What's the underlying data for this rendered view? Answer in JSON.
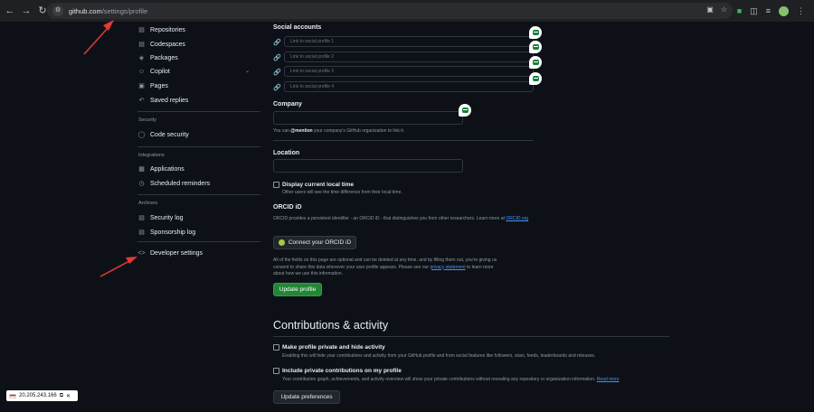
{
  "browser": {
    "url_host": "github.com",
    "url_path": "/settings/profile"
  },
  "sidebar": {
    "items": [
      {
        "label": "Repositories",
        "icon": "repo-icon"
      },
      {
        "label": "Codespaces",
        "icon": "codespaces-icon"
      },
      {
        "label": "Packages",
        "icon": "package-icon"
      },
      {
        "label": "Copilot",
        "icon": "copilot-icon"
      },
      {
        "label": "Pages",
        "icon": "browser-icon"
      },
      {
        "label": "Saved replies",
        "icon": "reply-icon"
      }
    ],
    "security_heading": "Security",
    "security_items": [
      {
        "label": "Code security",
        "icon": "shield-icon"
      }
    ],
    "integrations_heading": "Integrations",
    "integrations_items": [
      {
        "label": "Applications",
        "icon": "apps-icon"
      },
      {
        "label": "Scheduled reminders",
        "icon": "clock-icon"
      }
    ],
    "archives_heading": "Archives",
    "archives_items": [
      {
        "label": "Security log",
        "icon": "log-icon"
      },
      {
        "label": "Sponsorship log",
        "icon": "log-icon"
      }
    ],
    "developer_settings": "Developer settings"
  },
  "profile": {
    "social_label": "Social accounts",
    "social_placeholders": [
      "Link to social profile 1",
      "Link to social profile 2",
      "Link to social profile 3",
      "Link to social profile 4"
    ],
    "company_label": "Company",
    "company_note_pre": "You can",
    "company_note_mention": "@mention",
    "company_note_post": "your company's GitHub organization to link it.",
    "location_label": "Location",
    "local_time_label": "Display current local time",
    "local_time_note": "Other users will see the time difference from their local time.",
    "orcid_label": "ORCID iD",
    "orcid_note": "ORCID provides a persistent identifier - an ORCID iD - that distinguishes you from other researchers. Learn more at",
    "orcid_link": "ORCID.org",
    "orcid_button": "Connect your ORCID iD",
    "optional_note_1": "All of the fields on this page are optional and can be deleted at any time, and by filling them out, you're giving us",
    "optional_note_2": "consent to share this data wherever your user profile appears. Please see our",
    "privacy_link": "privacy statement",
    "optional_note_3": "to learn more",
    "optional_note_4": "about how we use this information.",
    "update_button": "Update profile"
  },
  "contributions": {
    "heading": "Contributions & activity",
    "private_label": "Make profile private and hide activity",
    "private_note": "Enabling this will hide your contributions and activity from your GitHub profile and from social features like followers, stars, feeds, leaderboards and releases.",
    "include_label": "Include private contributions on my profile",
    "include_note": "Your contribution graph, achievements, and activity overview will show your private contributions without revealing any repository or organization information.",
    "read_more": "Read more",
    "update_button": "Update preferences"
  },
  "ip_popup": {
    "ip": "20.205.243.166"
  },
  "colors": {
    "background": "#0d1117",
    "green_button": "#238636",
    "link": "#4493f8",
    "annotation_arrow": "#e53935"
  }
}
